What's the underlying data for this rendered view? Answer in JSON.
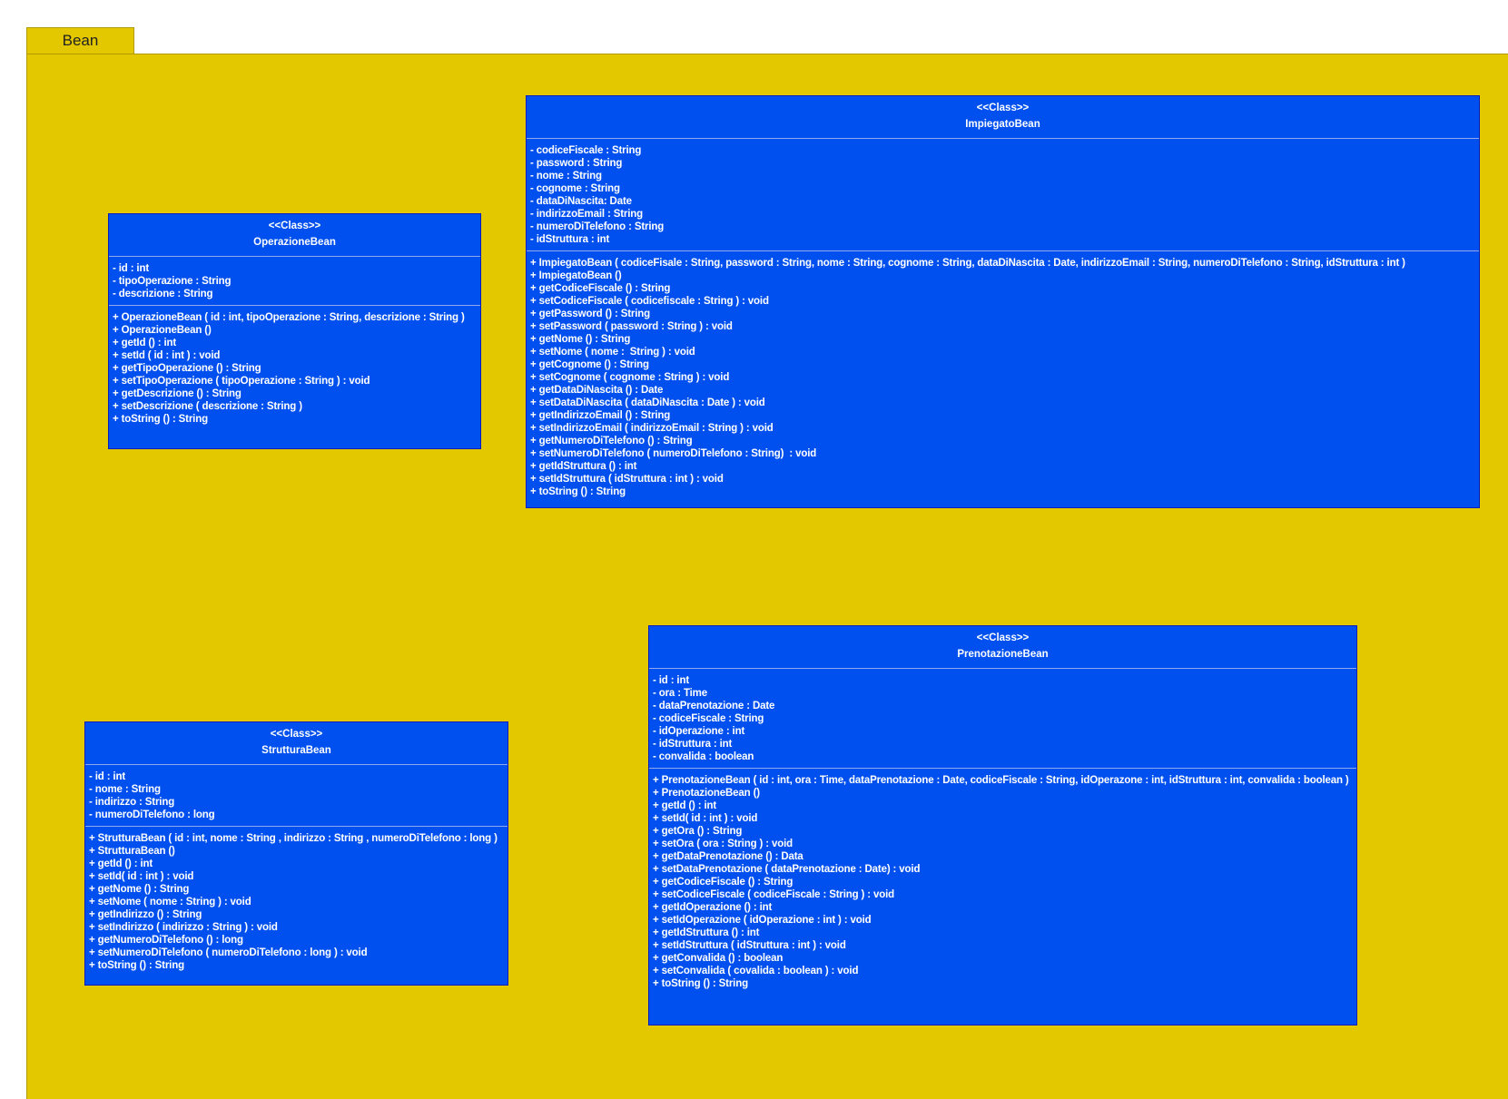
{
  "package": {
    "name": "Bean",
    "color": "#e3c800"
  },
  "class_fill_color": "#0050ef",
  "classes": [
    {
      "id": "operazione",
      "stereotype": "<<Class>>",
      "name": "OperazioneBean",
      "attributes": [
        "- id : int",
        "- tipoOperazione : String",
        "- descrizione : String"
      ],
      "operations": [
        "+ OperazioneBean ( id : int, tipoOperazione : String, descrizione : String )",
        "+ OperazioneBean ()",
        "+ getId () : int",
        "+ setId ( id : int ) : void",
        "+ getTipoOperazione () : String",
        "+ setTipoOperazione ( tipoOperazione : String ) : void",
        "+ getDescrizione () : String",
        "+ setDescrizione ( descrizione : String )",
        "+ toString () : String"
      ]
    },
    {
      "id": "impiegato",
      "stereotype": "<<Class>>",
      "name": "ImpiegatoBean",
      "attributes": [
        "- codiceFiscale : String",
        "- password : String",
        "- nome : String",
        "- cognome : String",
        "- dataDiNascita: Date",
        "- indirizzoEmail : String",
        "- numeroDiTelefono : String",
        "- idStruttura : int"
      ],
      "operations": [
        "+ ImpiegatoBean ( codiceFisale : String, password : String, nome : String, cognome : String, dataDiNascita : Date, indirizzoEmail : String, numeroDiTelefono : String, idStruttura : int )",
        "+ ImpiegatoBean ()",
        "+ getCodiceFiscale () : String",
        "+ setCodiceFiscale ( codicefiscale : String ) : void",
        "+ getPassword () : String",
        "+ setPassword ( password : String ) : void",
        "+ getNome () : String",
        "+ setNome ( nome :  String ) : void",
        "+ getCognome () : String",
        "+ setCognome ( cognome : String ) : void",
        "+ getDataDiNascita () : Date",
        "+ setDataDiNascita ( dataDiNascita : Date ) : void",
        "+ getIndirizzoEmail () : String",
        "+ setIndirizzoEmail ( indirizzoEmail : String ) : void",
        "+ getNumeroDiTelefono () : String",
        "+ setNumeroDiTelefono ( numeroDiTelefono : String)  : void",
        "+ getIdStruttura () : int",
        "+ setIdStruttura ( idStruttura : int ) : void",
        "+ toString () : String"
      ]
    },
    {
      "id": "struttura",
      "stereotype": "<<Class>>",
      "name": "StrutturaBean",
      "attributes": [
        "- id : int",
        "- nome : String",
        "- indirizzo : String",
        "- numeroDiTelefono : long"
      ],
      "operations": [
        "+ StrutturaBean ( id : int, nome : String , indirizzo : String , numeroDiTelefono : long )",
        "+ StrutturaBean ()",
        "+ getId () : int",
        "+ setId( id : int ) : void",
        "+ getNome () : String",
        "+ setNome ( nome : String ) : void",
        "+ getIndirizzo () : String",
        "+ setIndirizzo ( indirizzo : String ) : void",
        "+ getNumeroDiTelefono () : long",
        "+ setNumeroDiTelefono ( numeroDiTelefono : long ) : void",
        "+ toString () : String"
      ]
    },
    {
      "id": "prenotazione",
      "stereotype": "<<Class>>",
      "name": "PrenotazioneBean",
      "attributes": [
        "- id : int",
        "- ora : Time",
        "- dataPrenotazione : Date",
        "- codiceFiscale : String",
        "- idOperazione : int",
        "- idStruttura : int",
        "- convalida : boolean"
      ],
      "operations": [
        "+ PrenotazioneBean ( id : int, ora : Time, dataPrenotazione : Date, codiceFiscale : String, idOperazone : int, idStruttura : int, convalida : boolean )",
        "+ PrenotazioneBean ()",
        "+ getId () : int",
        "+ setId( id : int ) : void",
        "+ getOra () : String",
        "+ setOra ( ora : String ) : void",
        "+ getDataPrenotazione () : Data",
        "+ setDataPrenotazione ( dataPrenotazione : Date) : void",
        "+ getCodiceFiscale () : String",
        "+ setCodiceFiscale ( codiceFiscale : String ) : void",
        "+ getIdOperazione () : int",
        "+ setIdOperazione ( idOperazione : int ) : void",
        "+ getIdStruttura () : int",
        "+ setIdStruttura ( idStruttura : int ) : void",
        "+ getConvalida () : boolean",
        "+ setConvalida ( covalida : boolean ) : void",
        "+ toString () : String"
      ]
    }
  ]
}
